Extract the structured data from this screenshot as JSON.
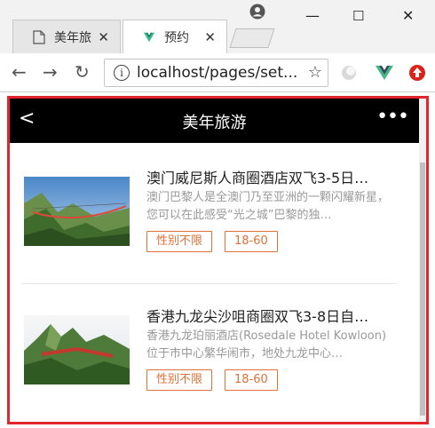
{
  "browser": {
    "tabs": [
      {
        "label": "美年旅",
        "active": false,
        "icon": "document-icon"
      },
      {
        "label": "预约",
        "active": true,
        "icon": "vue-icon"
      }
    ],
    "address": "localhost/pages/set..."
  },
  "app": {
    "title": "美年旅游",
    "items": [
      {
        "title": "澳门威尼斯人商圈酒店双飞3-5日…",
        "description": "澳门巴黎人是全澳门乃至亚洲的一颗闪耀新星，您可以在此感受“光之城”巴黎的独…",
        "tags": [
          "性别不限",
          "18-60"
        ]
      },
      {
        "title": "香港九龙尖沙咀商圈双飞3-8日自…",
        "description": "香港九龙珀丽酒店(Rosedale Hotel Kowloon)位于市中心繁华闹市，地处九龙中心…",
        "tags": [
          "性别不限",
          "18-60"
        ]
      }
    ]
  },
  "colors": {
    "highlight_border": "#e3262b",
    "tag": "#e0703a",
    "appbar": "#000000"
  }
}
